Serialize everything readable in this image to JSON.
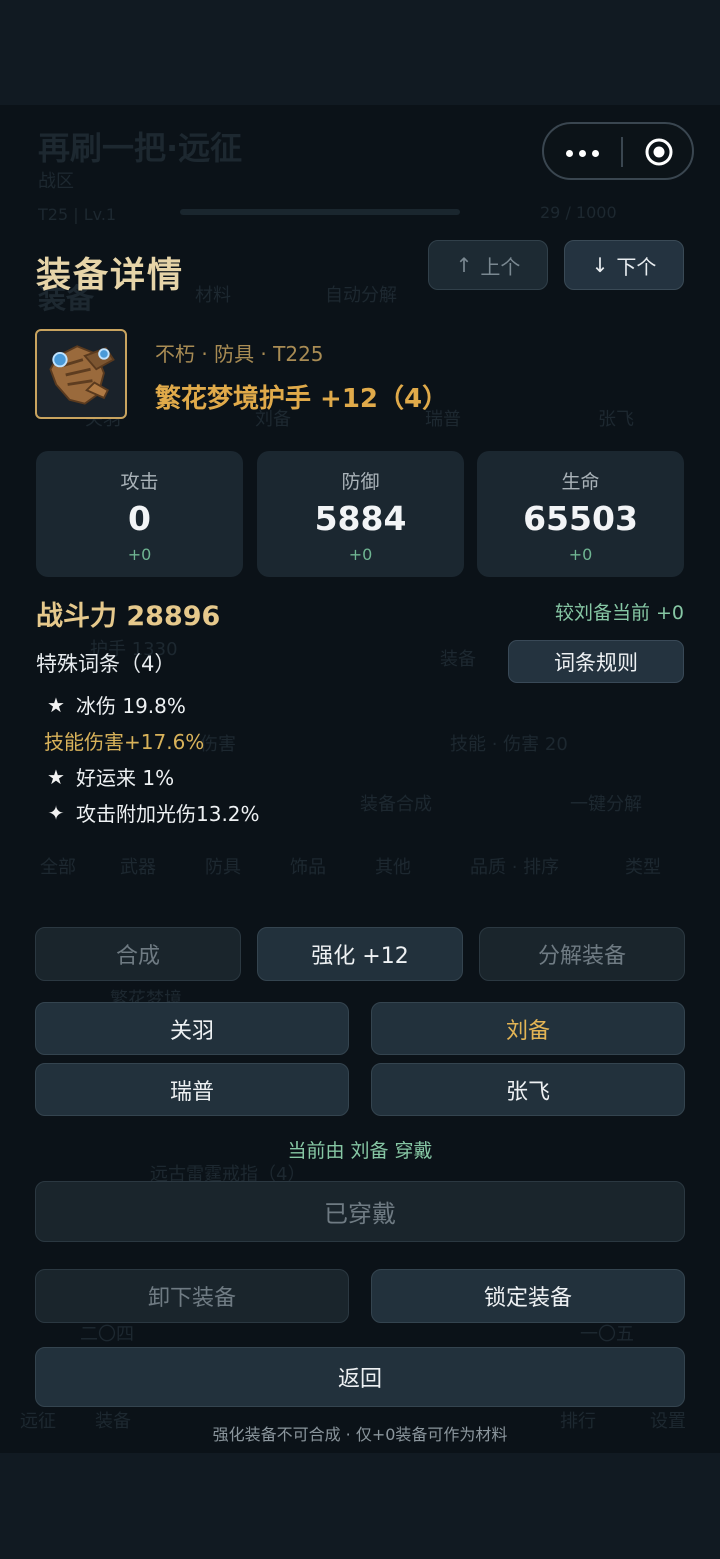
{
  "header": {
    "title": "装备详情",
    "prev_label": "上个",
    "next_label": "下个"
  },
  "item": {
    "icon": "gauntlet-icon",
    "meta": "不朽 · 防具 · T225",
    "name": "繁花梦境护手 +12（4）"
  },
  "stats": [
    {
      "label": "攻击",
      "value": "0",
      "delta": "+0"
    },
    {
      "label": "防御",
      "value": "5884",
      "delta": "+0"
    },
    {
      "label": "生命",
      "value": "65503",
      "delta": "+0"
    }
  ],
  "power": "战斗力 28896",
  "compare": "较刘备当前 +0",
  "special_title": "特殊词条（4）",
  "rule_button": "词条规则",
  "affixes": [
    {
      "icon": "star-icon",
      "glyph": "★",
      "text": "冰伤 19.8%"
    },
    {
      "icon": "",
      "glyph": "",
      "text": "技能伤害+17.6%"
    },
    {
      "icon": "star-icon",
      "glyph": "★",
      "text": "好运来 1%"
    },
    {
      "icon": "sparkle-icon",
      "glyph": "✦",
      "text": "攻击附加光伤13.2%"
    }
  ],
  "actions": {
    "synth": "合成",
    "enhance": "强化 +12",
    "decompose": "分解装备"
  },
  "heroes": [
    "关羽",
    "刘备",
    "瑞普",
    "张飞"
  ],
  "selected_hero": "刘备",
  "worn_by": "当前由 刘备 穿戴",
  "equipped": "已穿戴",
  "unequip": "卸下装备",
  "lock": "锁定装备",
  "back": "返回",
  "footer_note": "强化装备不可合成 · 仅+0装备可作为材料",
  "colors": {
    "accent_gold": "#e0aa4a",
    "positive_green": "#86c7a4",
    "panel": "#1b2730",
    "background": "#0b1218"
  }
}
